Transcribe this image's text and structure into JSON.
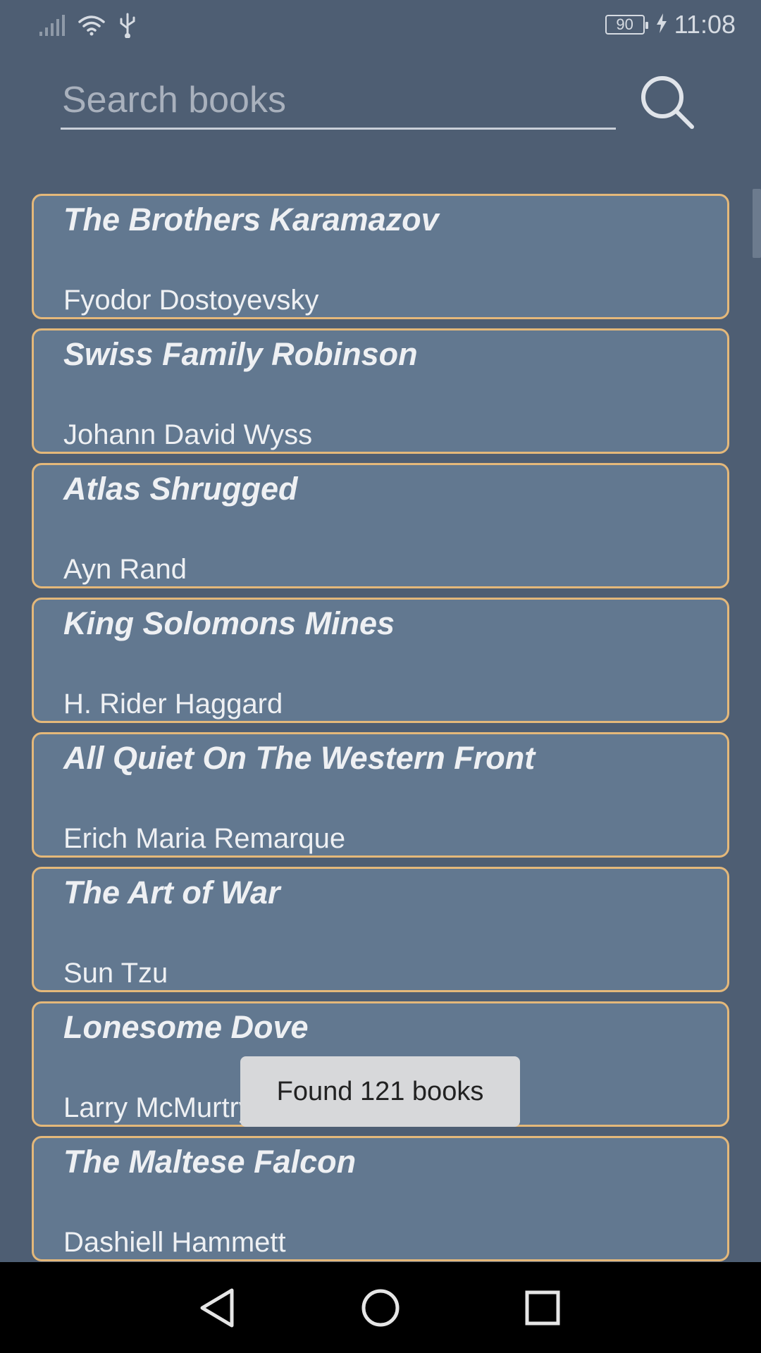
{
  "status_bar": {
    "battery": "90",
    "time": "11:08"
  },
  "search": {
    "placeholder": "Search books"
  },
  "books": [
    {
      "title": "The Brothers Karamazov",
      "author": "Fyodor Dostoyevsky"
    },
    {
      "title": "Swiss Family Robinson",
      "author": "Johann David Wyss"
    },
    {
      "title": "Atlas Shrugged",
      "author": "Ayn Rand"
    },
    {
      "title": "King Solomons Mines",
      "author": "H. Rider Haggard"
    },
    {
      "title": "All Quiet On The Western Front",
      "author": "Erich Maria Remarque"
    },
    {
      "title": "The Art of War",
      "author": "Sun Tzu"
    },
    {
      "title": "Lonesome Dove",
      "author": "Larry McMurtry"
    },
    {
      "title": "The Maltese Falcon",
      "author": "Dashiell Hammett"
    }
  ],
  "toast": {
    "message": "Found 121 books"
  },
  "colors": {
    "background": "#4e5e73",
    "card": "#627890",
    "card_border": "#e4b87a"
  }
}
